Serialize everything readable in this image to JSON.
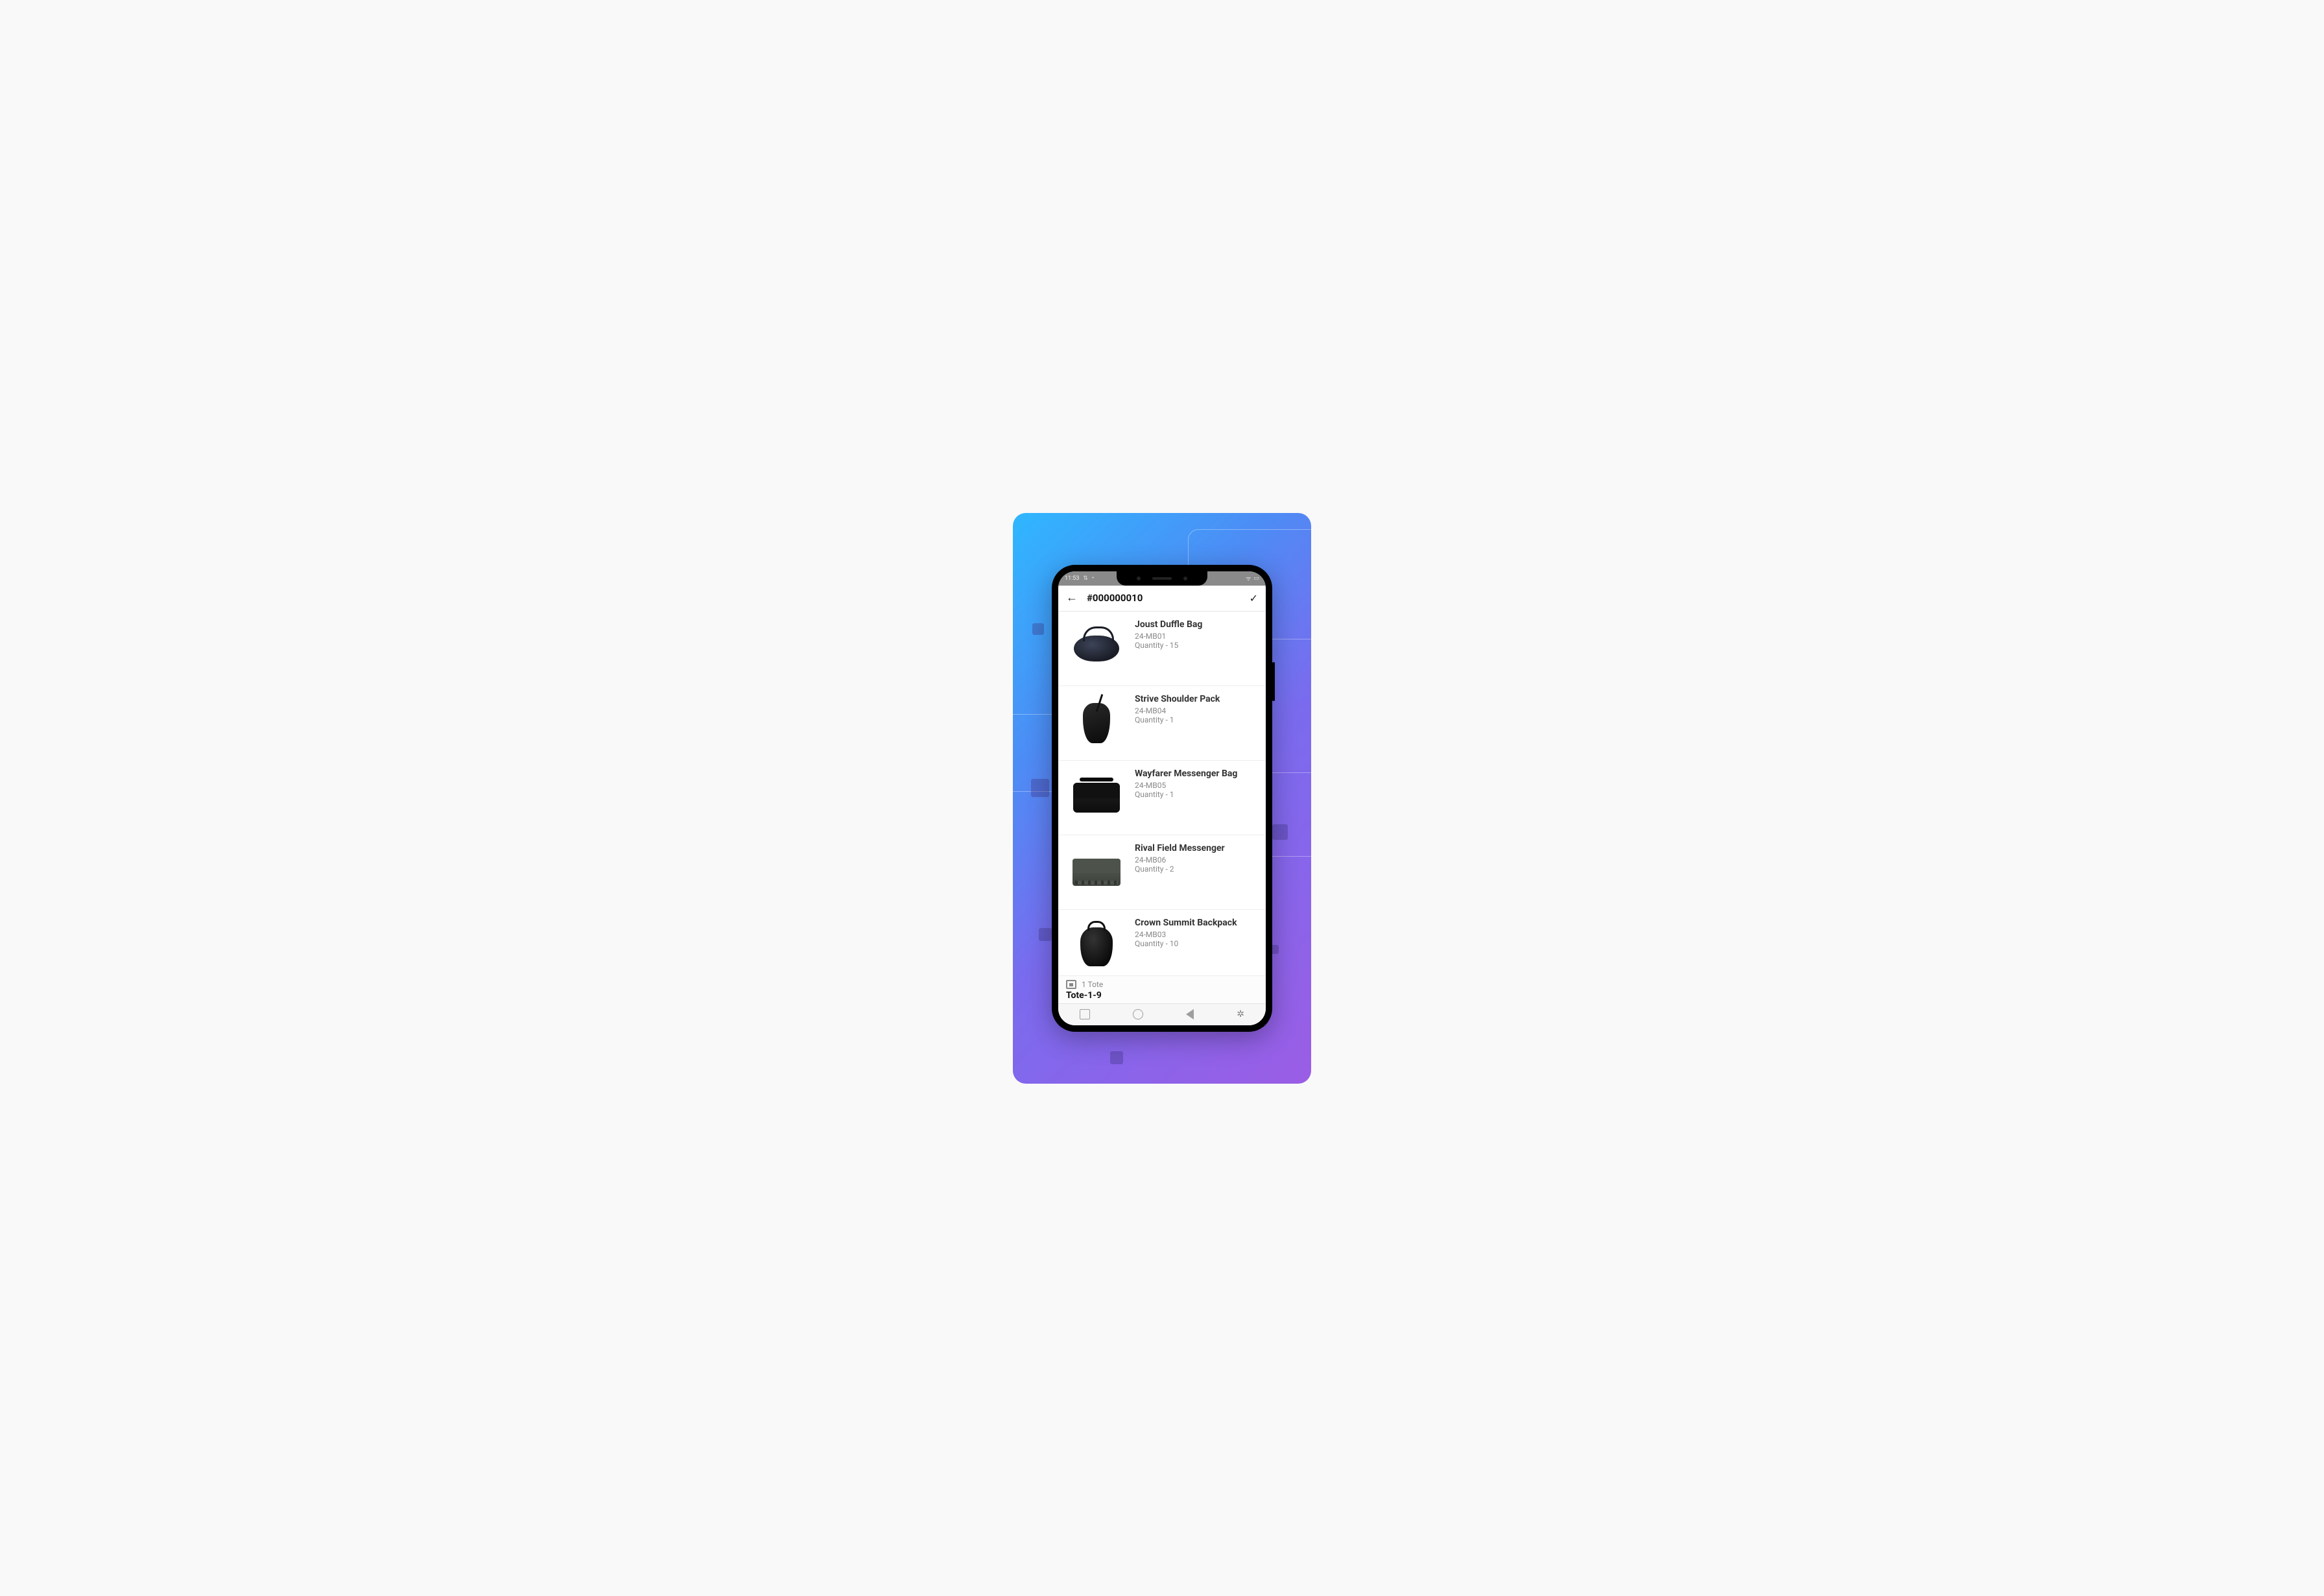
{
  "statusbar": {
    "time": "11:53",
    "signal_icon": "⇅",
    "extra_icon": "•",
    "wifi_icon": "ᯤ",
    "battery_icon": "▭"
  },
  "appbar": {
    "title": "#000000010",
    "back_icon": "←",
    "confirm_icon": "✓"
  },
  "items": [
    {
      "name": "Joust Duffle Bag",
      "sku": "24-MB01",
      "qty": "Quantity - 15",
      "bag_class": "bag-duffle"
    },
    {
      "name": "Strive Shoulder Pack",
      "sku": "24-MB04",
      "qty": "Quantity - 1",
      "bag_class": "bag-sling"
    },
    {
      "name": "Wayfarer Messenger Bag",
      "sku": "24-MB05",
      "qty": "Quantity - 1",
      "bag_class": "bag-mess"
    },
    {
      "name": "Rival Field Messenger",
      "sku": "24-MB06",
      "qty": "Quantity - 2",
      "bag_class": "bag-field"
    },
    {
      "name": "Crown Summit Backpack",
      "sku": "24-MB03",
      "qty": "Quantity - 10",
      "bag_class": "bag-back"
    }
  ],
  "tote": {
    "count_label": "1 Tote",
    "name": "Tote-1-9"
  }
}
